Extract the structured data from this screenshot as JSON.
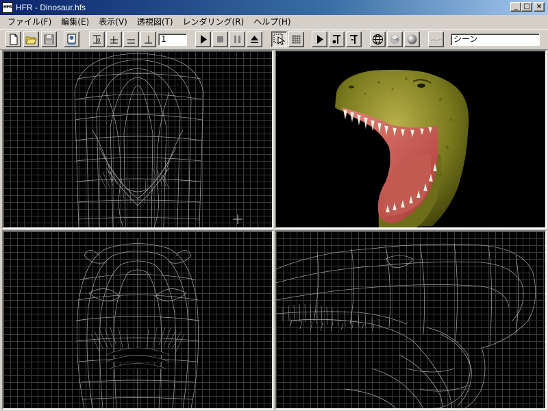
{
  "window": {
    "title": "HFR - Dinosaur.hfs",
    "icon_label": "HFR",
    "minimize": "_",
    "maximize": "□",
    "close": "×"
  },
  "menu": [
    {
      "label": "ファイル(F)"
    },
    {
      "label": "編集(E)"
    },
    {
      "label": "表示(V)"
    },
    {
      "label": "透視図(T)"
    },
    {
      "label": "レンダリング(R)"
    },
    {
      "label": "ヘルプ(H)"
    }
  ],
  "toolbar": {
    "frame_value": "1",
    "scene_value": "シーン",
    "buttons": [
      "new-file",
      "open-folder",
      "save-disk",
      "properties",
      "frame-start",
      "frame-prev",
      "frame-next",
      "frame-end",
      "play",
      "stop",
      "pause",
      "eject",
      "select-arrow",
      "grid",
      "play-anim",
      "key-set",
      "key-delete",
      "wireframe-sphere",
      "flat-sphere",
      "smooth-sphere",
      "line-tool"
    ]
  },
  "colors": {
    "titlebar_start": "#0a246a",
    "titlebar_end": "#a6caf0",
    "viewport_bg": "#000000",
    "grid": "#3a3a3a",
    "wireframe": "#9a9a9a",
    "dino_skin": "#7a7a1e",
    "dino_mouth": "#d0605a"
  },
  "viewports": [
    {
      "name": "front",
      "mode": "wireframe"
    },
    {
      "name": "perspective",
      "mode": "rendered"
    },
    {
      "name": "top",
      "mode": "wireframe"
    },
    {
      "name": "side",
      "mode": "wireframe"
    }
  ]
}
